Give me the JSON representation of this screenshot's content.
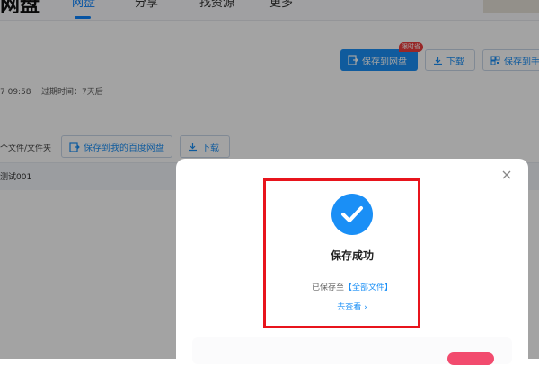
{
  "header": {
    "brand": "网盘",
    "tabs": [
      "网盘",
      "分享",
      "找资源",
      "更多"
    ]
  },
  "actions": {
    "save_to_netdisk": "保存到网盘",
    "badge": "限时省",
    "download": "下载",
    "save_to_phone": "保存到手"
  },
  "share_info": {
    "meta_text": "7 09:58    过期时间：7天后"
  },
  "file_list": {
    "count_label": "个文件/文件夹",
    "save_to_baidu": "保存到我的百度网盘",
    "download": "下载",
    "rows": [
      "测试001"
    ]
  },
  "modal": {
    "title": "保存成功",
    "saved_prefix": "已保存至",
    "saved_link": "【全部文件】",
    "view_link": "去查看 ›"
  },
  "colors": {
    "accent": "#1a8ff6",
    "highlight_box": "#e8141c",
    "badge": "#ee3e3e"
  }
}
